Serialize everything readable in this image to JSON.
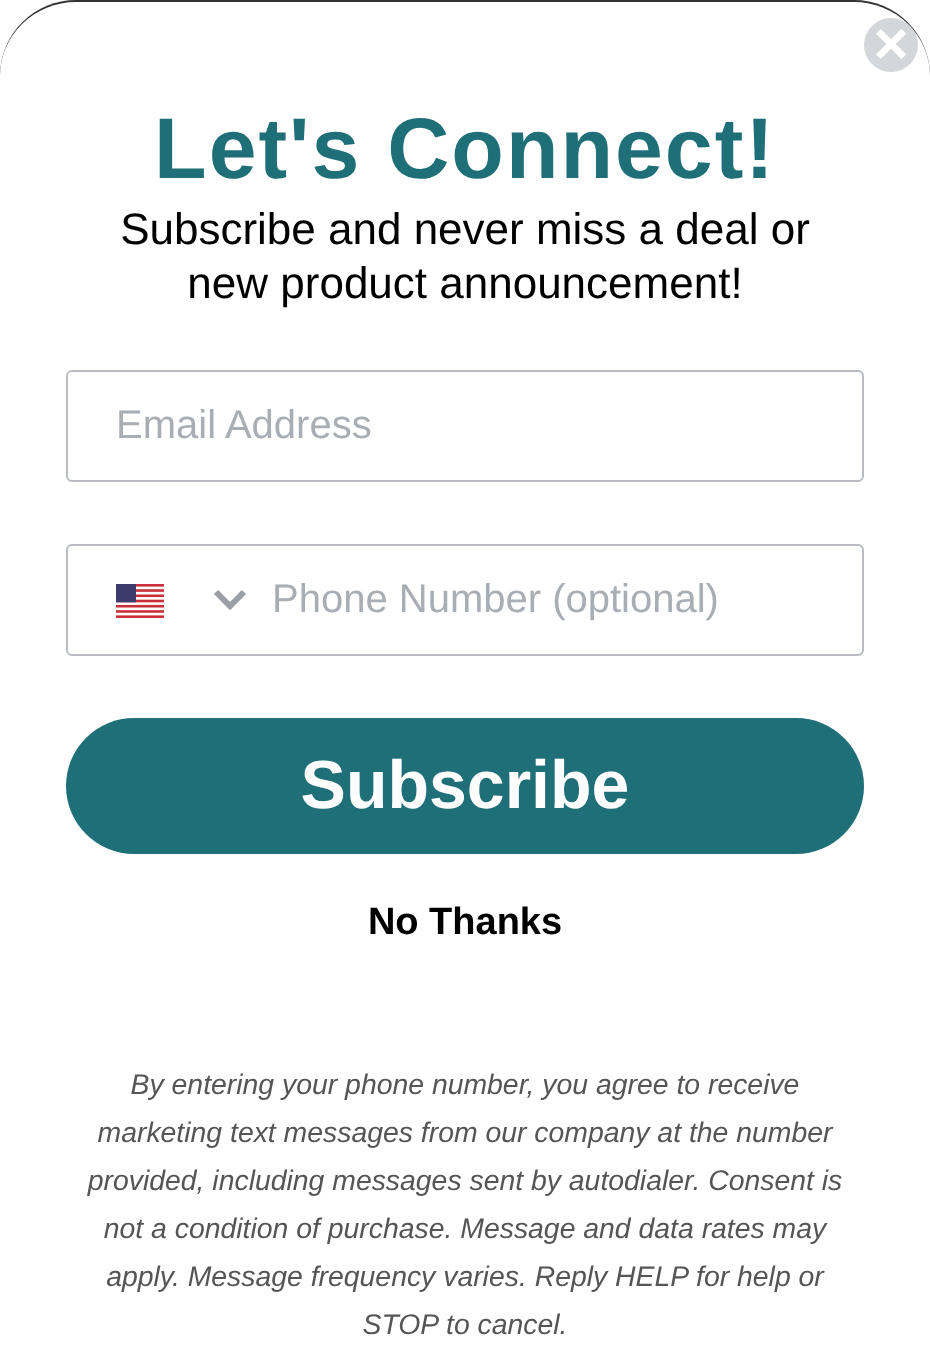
{
  "popup": {
    "close": "×",
    "title": "Let's Connect!",
    "subtitle": "Subscribe and never miss a deal or new product announcement!",
    "fields": [
      {
        "kind": "email",
        "placeholder": "Email Address"
      },
      {
        "kind": "phone",
        "placeholder": "Phone Number (optional)"
      }
    ],
    "subscribe": "Subscribe",
    "no_thanks": "No Thanks",
    "disclaimer": "By entering your phone number, you agree to receive marketing text messages from our company at the number provided, including messages sent by autodialer. Consent is not a condition of purchase. Message and data rates may apply. Message frequency varies. Reply HELP for help or STOP to cancel."
  }
}
